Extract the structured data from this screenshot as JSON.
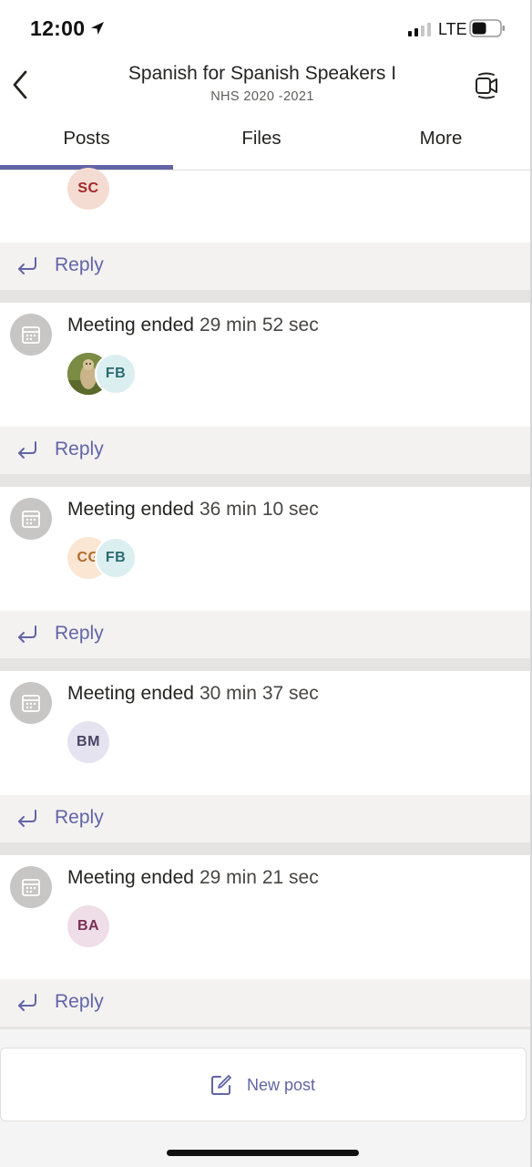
{
  "status_bar": {
    "time": "12:00",
    "network": "LTE"
  },
  "header": {
    "title": "Spanish for Spanish Speakers I",
    "subtitle": "NHS 2020 -2021",
    "back_icon": "chevron-left-icon",
    "video_icon": "meet-now-icon"
  },
  "tabs": [
    {
      "label": "Posts",
      "selected": true
    },
    {
      "label": "Files",
      "selected": false
    },
    {
      "label": "More",
      "selected": false
    }
  ],
  "feed": {
    "reply_label": "Reply",
    "first_card_avatar": {
      "initials": "SC",
      "bg": "#f4dcd2",
      "fg": "#a4262c"
    },
    "posts": [
      {
        "title": "Meeting ended",
        "duration": "29 min 52 sec",
        "avatars": [
          {
            "initials": "",
            "photo": true
          },
          {
            "initials": "FB",
            "bg": "#dbeff1",
            "fg": "#2b6a71"
          }
        ]
      },
      {
        "title": "Meeting ended",
        "duration": "36 min 10 sec",
        "avatars": [
          {
            "initials": "CG",
            "bg": "#fbe5d3",
            "fg": "#b06a2b"
          },
          {
            "initials": "FB",
            "bg": "#dbeff1",
            "fg": "#2b6a71"
          }
        ]
      },
      {
        "title": "Meeting ended",
        "duration": "30 min 37 sec",
        "avatars": [
          {
            "initials": "BM",
            "bg": "#e5e3f0",
            "fg": "#4a4464"
          }
        ]
      },
      {
        "title": "Meeting ended",
        "duration": "29 min 21 sec",
        "avatars": [
          {
            "initials": "BA",
            "bg": "#efdde7",
            "fg": "#7a2d55"
          }
        ]
      }
    ]
  },
  "new_post": {
    "label": "New post",
    "icon": "compose-icon"
  },
  "colors": {
    "accent": "#6264a7",
    "background": "#f5f4f4"
  }
}
